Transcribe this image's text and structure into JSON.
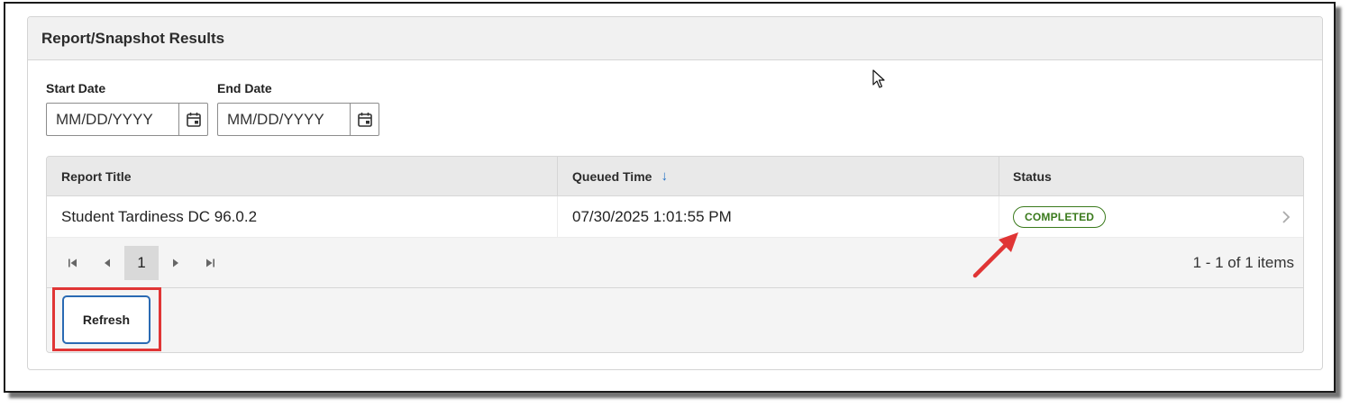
{
  "panel": {
    "title": "Report/Snapshot Results"
  },
  "filters": {
    "start_date": {
      "label": "Start Date",
      "placeholder": "MM/DD/YYYY",
      "value": ""
    },
    "end_date": {
      "label": "End Date",
      "placeholder": "MM/DD/YYYY",
      "value": ""
    },
    "calendar_icon": "calendar-icon"
  },
  "table": {
    "columns": [
      {
        "label": "Report Title"
      },
      {
        "label": "Queued Time",
        "sort": "descending",
        "sort_icon": "arrow-down-icon"
      },
      {
        "label": "Status"
      }
    ],
    "rows": [
      {
        "title": "Student Tardiness DC 96.0.2",
        "queued_time": "07/30/2025 1:01:55 PM",
        "status": "COMPLETED"
      }
    ]
  },
  "pager": {
    "current_page": "1",
    "info": "1 - 1 of 1 items",
    "icons": [
      "first-page-icon",
      "previous-page-icon",
      "next-page-icon",
      "last-page-icon"
    ]
  },
  "footer": {
    "refresh_label": "Refresh"
  },
  "colors": {
    "status_completed": "#3a7a1c",
    "sort_accent": "#1f6fc5",
    "annotation_red": "#e03535",
    "button_focus": "#2a6ab3"
  }
}
